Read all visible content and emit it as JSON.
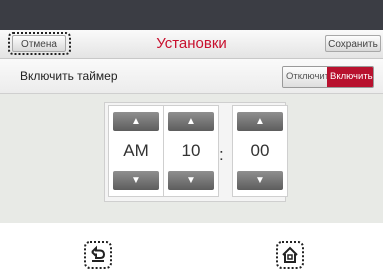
{
  "header": {
    "cancel_label": "Отмена",
    "title": "Установки",
    "save_label": "Сохранить"
  },
  "timer_row": {
    "label": "Включить таймер",
    "toggle_off": "Отключить",
    "toggle_on": "Включить",
    "active": "on"
  },
  "time": {
    "ampm": "AM",
    "hour": "10",
    "minute": "00",
    "separator": ":"
  },
  "spinner_icons": {
    "up": "▲",
    "down": "▼"
  },
  "bottom_nav": {
    "back_icon": "back-arrow-icon",
    "home_icon": "home-icon"
  },
  "colors": {
    "accent": "#c8102e",
    "toggle_active": "#b8112e"
  }
}
